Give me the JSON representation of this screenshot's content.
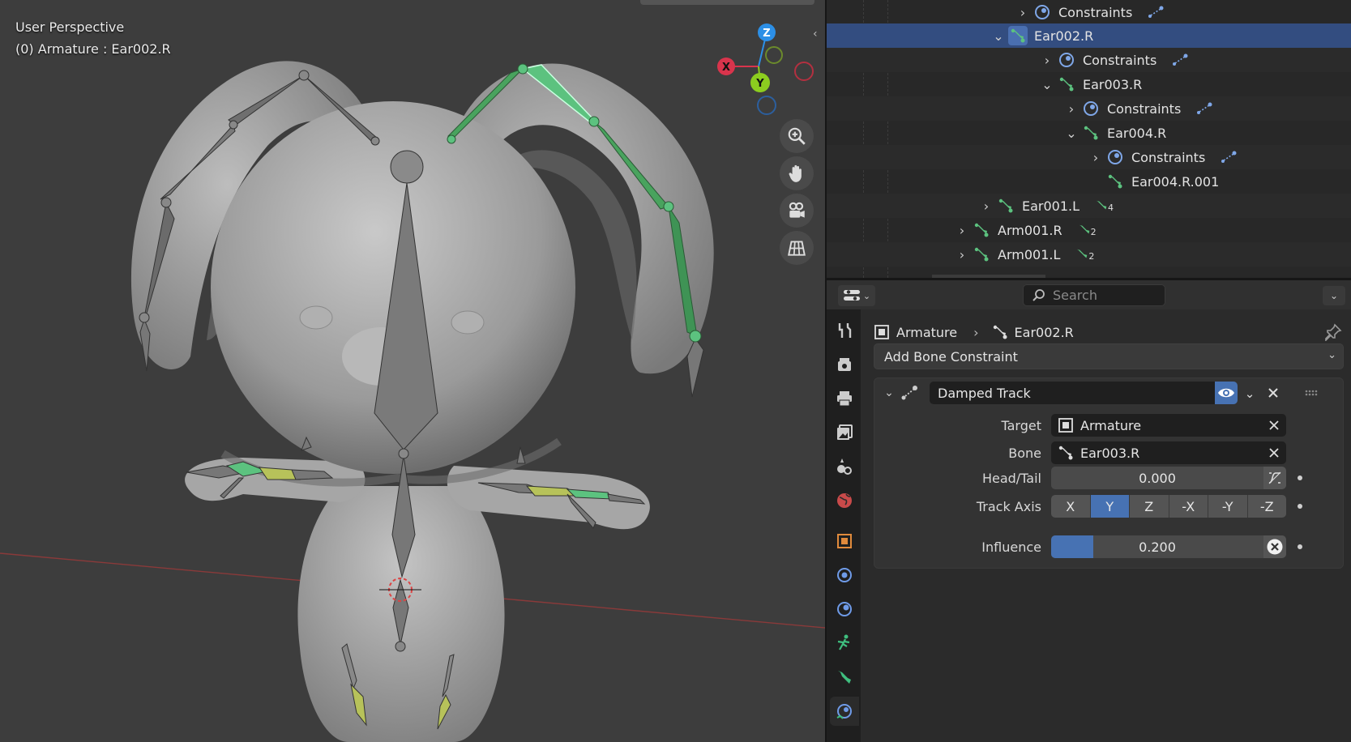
{
  "viewport": {
    "perspective_label": "User Perspective",
    "active_object_label": "(0) Armature : Ear002.R",
    "gizmo": {
      "z": "Z",
      "x": "X",
      "y": "Y"
    },
    "nav_buttons": [
      "zoom-icon",
      "hand-icon",
      "camera-icon",
      "grid-icon"
    ]
  },
  "outliner": {
    "rows": [
      {
        "label": "Constraints",
        "type": "constraint"
      },
      {
        "label": "Ear002.R",
        "type": "bone"
      },
      {
        "label": "Constraints",
        "type": "constraint"
      },
      {
        "label": "Ear003.R",
        "type": "bone"
      },
      {
        "label": "Constraints",
        "type": "constraint"
      },
      {
        "label": "Ear004.R",
        "type": "bone"
      },
      {
        "label": "Constraints",
        "type": "constraint"
      },
      {
        "label": "Ear004.R.001",
        "type": "bone"
      },
      {
        "label": "Ear001.L",
        "type": "bone",
        "child_count": "4"
      },
      {
        "label": "Arm001.R",
        "type": "bone",
        "child_count": "2"
      },
      {
        "label": "Arm001.L",
        "type": "bone",
        "child_count": "2"
      }
    ]
  },
  "properties": {
    "search_placeholder": "Search",
    "breadcrumb": {
      "object": "Armature",
      "bone": "Ear002.R"
    },
    "add_constraint_label": "Add Bone Constraint",
    "constraint": {
      "name": "Damped Track",
      "target_label": "Target",
      "target_value": "Armature",
      "bone_label": "Bone",
      "bone_value": "Ear003.R",
      "headtail_label": "Head/Tail",
      "headtail_value": "0.000",
      "track_axis_label": "Track Axis",
      "track_axis_options": [
        "X",
        "Y",
        "Z",
        "-X",
        "-Y",
        "-Z"
      ],
      "track_axis_selected": "Y",
      "influence_label": "Influence",
      "influence_value": "0.200",
      "influence_fraction": 0.2
    }
  },
  "colors": {
    "accent": "#4772b3",
    "bone_selected": "#5cc27f",
    "outliner_selected": "#334d80",
    "axis_x": "#d9344c",
    "axis_y": "#8ccd1f",
    "axis_z": "#2c8fe6"
  }
}
